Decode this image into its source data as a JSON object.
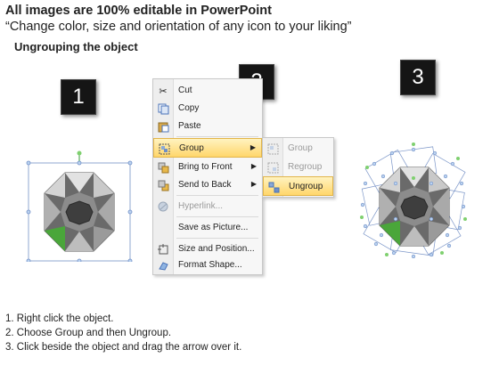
{
  "header": {
    "title": "All images are 100% editable in PowerPoint",
    "subtitle": "“Change color, size and orientation of any icon to your liking”",
    "section": "Ungrouping the object"
  },
  "badges": [
    "1",
    "2",
    "3"
  ],
  "context_menu": {
    "items": [
      {
        "label": "Cut",
        "icon": "scissors-icon"
      },
      {
        "label": "Copy",
        "icon": "copy-icon"
      },
      {
        "label": "Paste",
        "icon": "paste-icon"
      },
      {
        "label": "Group",
        "icon": "group-icon",
        "highlighted": true,
        "submenu": true
      },
      {
        "label": "Bring to Front",
        "icon": "bring-to-front-icon",
        "submenu": true
      },
      {
        "label": "Send to Back",
        "icon": "send-to-back-icon",
        "submenu": true
      },
      {
        "label": "Hyperlink...",
        "icon": "hyperlink-icon",
        "disabled": true
      },
      {
        "label": "Save as Picture...",
        "icon": ""
      },
      {
        "label": "Size and Position...",
        "icon": "size-position-icon"
      },
      {
        "label": "Format Shape...",
        "icon": "format-shape-icon"
      }
    ]
  },
  "submenu": {
    "items": [
      {
        "label": "Group",
        "icon": "group-icon",
        "disabled": true
      },
      {
        "label": "Regroup",
        "icon": "regroup-icon",
        "disabled": true
      },
      {
        "label": "Ungroup",
        "icon": "ungroup-icon",
        "highlighted": true
      }
    ]
  },
  "steps": [
    "1.  Right click the object.",
    "2.  Choose Group and then Ungroup.",
    "3.  Click beside the object and drag the arrow over it."
  ],
  "colors": {
    "accent_green": "#4aa63a",
    "shape_gray": "#8a8a8a",
    "selection_blue": "#6f8fc6"
  }
}
